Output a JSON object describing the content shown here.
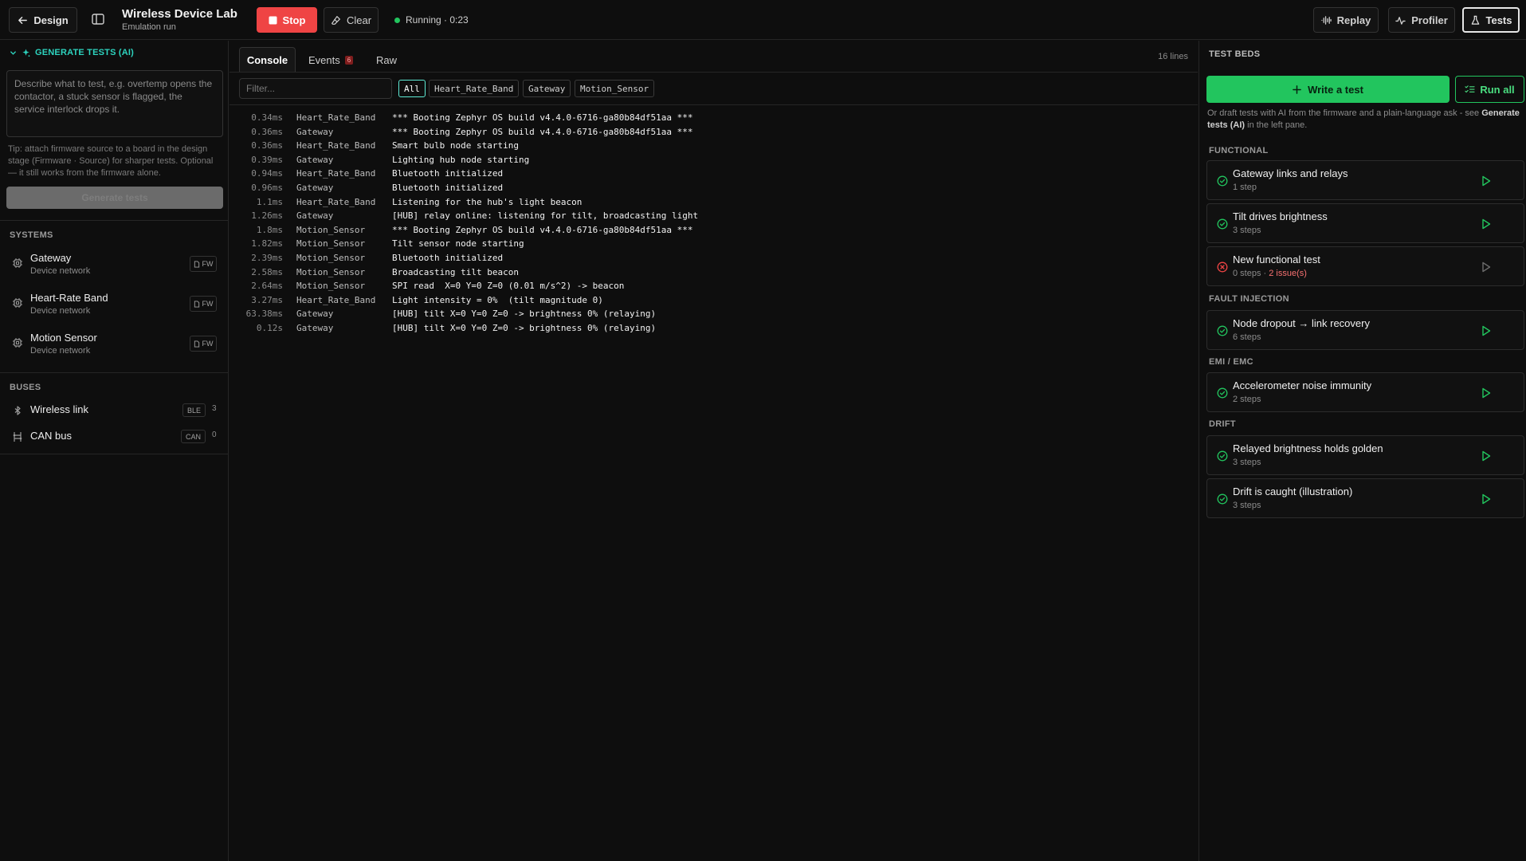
{
  "header": {
    "back_label": "Design",
    "title": "Wireless Device Lab",
    "subtitle": "Emulation run",
    "stop_label": "Stop",
    "clear_label": "Clear",
    "status": "Running · 0:23",
    "replay_label": "Replay",
    "profiler_label": "Profiler",
    "tests_label": "Tests"
  },
  "left": {
    "generate_title": "GENERATE TESTS (AI)",
    "prompt_placeholder": "Describe what to test, e.g. overtemp opens the contactor, a stuck sensor is flagged, the service interlock drops it.",
    "tip": "Tip: attach firmware source to a board in the design stage (Firmware · Source) for sharper tests. Optional — it still works from the firmware alone.",
    "generate_button": "Generate tests",
    "systems_label": "SYSTEMS",
    "systems": [
      {
        "name": "Gateway",
        "sub": "Device network",
        "badge": "FW"
      },
      {
        "name": "Heart-Rate Band",
        "sub": "Device network",
        "badge": "FW"
      },
      {
        "name": "Motion Sensor",
        "sub": "Device network",
        "badge": "FW"
      }
    ],
    "buses_label": "BUSES",
    "buses": [
      {
        "name": "Wireless link",
        "badge": "BLE",
        "count": "3"
      },
      {
        "name": "CAN bus",
        "badge": "CAN",
        "count": "0"
      }
    ]
  },
  "console": {
    "tabs": [
      {
        "label": "Console"
      },
      {
        "label": "Events",
        "badge": "6"
      },
      {
        "label": "Raw"
      }
    ],
    "line_count": "16 lines",
    "filter_placeholder": "Filter...",
    "chips": [
      "All",
      "Heart_Rate_Band",
      "Gateway",
      "Motion_Sensor"
    ],
    "lines": [
      {
        "t": "0.34ms",
        "src": "Heart_Rate_Band",
        "msg": "*** Booting Zephyr OS build v4.4.0-6716-ga80b84df51aa ***"
      },
      {
        "t": "0.36ms",
        "src": "Gateway",
        "msg": "*** Booting Zephyr OS build v4.4.0-6716-ga80b84df51aa ***"
      },
      {
        "t": "0.36ms",
        "src": "Heart_Rate_Band",
        "msg": "Smart bulb node starting"
      },
      {
        "t": "0.39ms",
        "src": "Gateway",
        "msg": "Lighting hub node starting"
      },
      {
        "t": "0.94ms",
        "src": "Heart_Rate_Band",
        "msg": "Bluetooth initialized"
      },
      {
        "t": "0.96ms",
        "src": "Gateway",
        "msg": "Bluetooth initialized"
      },
      {
        "t": "1.1ms",
        "src": "Heart_Rate_Band",
        "msg": "Listening for the hub's light beacon"
      },
      {
        "t": "1.26ms",
        "src": "Gateway",
        "msg": "[HUB] relay online: listening for tilt, broadcasting light"
      },
      {
        "t": "1.8ms",
        "src": "Motion_Sensor",
        "msg": "*** Booting Zephyr OS build v4.4.0-6716-ga80b84df51aa ***"
      },
      {
        "t": "1.82ms",
        "src": "Motion_Sensor",
        "msg": "Tilt sensor node starting"
      },
      {
        "t": "2.39ms",
        "src": "Motion_Sensor",
        "msg": "Bluetooth initialized"
      },
      {
        "t": "2.58ms",
        "src": "Motion_Sensor",
        "msg": "Broadcasting tilt beacon"
      },
      {
        "t": "2.64ms",
        "src": "Motion_Sensor",
        "msg": "SPI read  X=0 Y=0 Z=0 (0.01 m/s^2) -> beacon"
      },
      {
        "t": "3.27ms",
        "src": "Heart_Rate_Band",
        "msg": "Light intensity = 0%  (tilt magnitude 0)"
      },
      {
        "t": "63.38ms",
        "src": "Gateway",
        "msg": "[HUB] tilt X=0 Y=0 Z=0 -> brightness 0% (relaying)"
      },
      {
        "t": "0.12s",
        "src": "Gateway",
        "msg": "[HUB] tilt X=0 Y=0 Z=0 -> brightness 0% (relaying)"
      }
    ]
  },
  "right": {
    "title": "TEST BEDS",
    "write_label": "Write a test",
    "runall_label": "Run all",
    "help_pre": "Or draft tests with AI from the firmware and a plain-language ask - see ",
    "help_bold": "Generate tests (AI)",
    "help_post": " in the left pane.",
    "categories": [
      {
        "label": "FUNCTIONAL",
        "tests": [
          {
            "name": "Gateway links and relays",
            "steps": "1 step",
            "status": "ok"
          },
          {
            "name": "Tilt drives brightness",
            "steps": "3 steps",
            "status": "ok"
          },
          {
            "name": "New functional test",
            "steps": "0 steps · ",
            "issues": "2 issue(s)",
            "status": "error"
          }
        ]
      },
      {
        "label": "FAULT INJECTION",
        "tests": [
          {
            "name": "Node dropout → link recovery",
            "steps": "6 steps",
            "status": "ok"
          }
        ]
      },
      {
        "label": "EMI / EMC",
        "tests": [
          {
            "name": "Accelerometer noise immunity",
            "steps": "2 steps",
            "status": "ok"
          }
        ]
      },
      {
        "label": "DRIFT",
        "tests": [
          {
            "name": "Relayed brightness holds golden",
            "steps": "3 steps",
            "status": "ok"
          },
          {
            "name": "Drift is caught (illustration)",
            "steps": "3 steps",
            "status": "ok"
          }
        ]
      }
    ]
  },
  "colors": {
    "accent": "#2dd4bf",
    "success": "#22c55e",
    "danger": "#ef4444"
  }
}
